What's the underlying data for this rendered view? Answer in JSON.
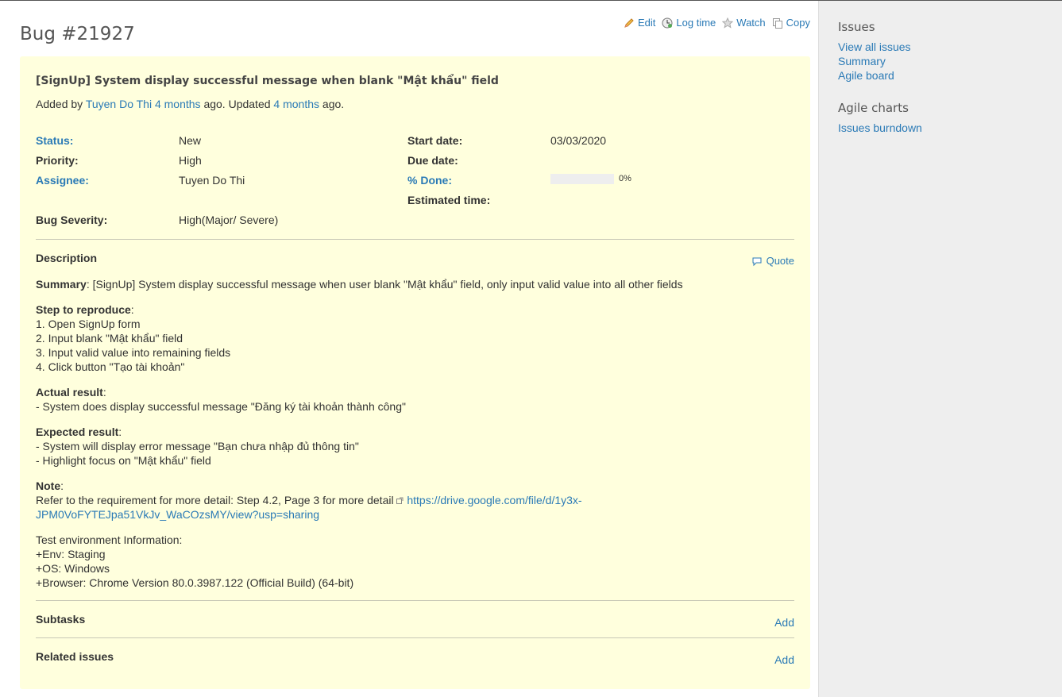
{
  "issue": {
    "title": "Bug #21927",
    "subject": "[SignUp] System display successful message when blank \"Mật khẩu\" field",
    "author_prefix": "Added by",
    "author": "Tuyen Do Thi",
    "created_ago": "4 months",
    "ago_updated": "ago. Updated",
    "updated_ago": "4 months",
    "ago_end": "ago."
  },
  "actions": {
    "edit": "Edit",
    "log_time": "Log time",
    "watch": "Watch",
    "copy": "Copy"
  },
  "attributes": {
    "status_label": "Status:",
    "status_value": "New",
    "priority_label": "Priority:",
    "priority_value": "High",
    "assignee_label": "Assignee:",
    "assignee_value": "Tuyen Do Thi",
    "bug_severity_label": "Bug Severity:",
    "bug_severity_value": "High(Major/ Severe)",
    "start_date_label": "Start date:",
    "start_date_value": "03/03/2020",
    "due_date_label": "Due date:",
    "due_date_value": "",
    "done_label": "% Done:",
    "done_value": "0%",
    "done_fraction": 0,
    "estimated_label": "Estimated time:",
    "estimated_value": ""
  },
  "description": {
    "heading": "Description",
    "quote": "Quote",
    "summary_label": "Summary",
    "summary_text": ": [SignUp] System display successful message when user blank \"Mật khẩu\" field, only input valid value into all other fields",
    "steps_label": "Step to reproduce",
    "colon": ":",
    "steps": [
      "1. Open SignUp form",
      "2. Input blank \"Mật khẩu\" field",
      "3. Input valid value into remaining fields",
      "4. Click button \"Tạo tài khoản\""
    ],
    "actual_label": "Actual result",
    "actual": [
      "- System does display successful message \"Đăng ký tài khoản thành công\""
    ],
    "expected_label": "Expected result",
    "expected": [
      "- System will display error message \"Bạn chưa nhập đủ thông tin\"",
      "- Highlight focus on \"Mật khẩu\" field"
    ],
    "note_label": "Note",
    "note_text": "Refer to the requirement for more detail: Step 4.2, Page 3 for more detail",
    "note_link_1": "https://drive.google.com/file/d/1y3x-",
    "note_link_2": "JPM0VoFYTEJpa51VkJv_WaCOzsMY/view?usp=sharing",
    "env": [
      "Test environment Information:",
      "+Env: Staging",
      "+OS: Windows",
      "+Browser: Chrome Version 80.0.3987.122 (Official Build) (64-bit)"
    ]
  },
  "subtasks": {
    "heading": "Subtasks",
    "add": "Add"
  },
  "related": {
    "heading": "Related issues",
    "add": "Add"
  },
  "sidebar": {
    "issues_heading": "Issues",
    "links": [
      "View all issues",
      "Summary",
      "Agile board"
    ],
    "agile_heading": "Agile charts",
    "agile_links": [
      "Issues burndown"
    ]
  }
}
